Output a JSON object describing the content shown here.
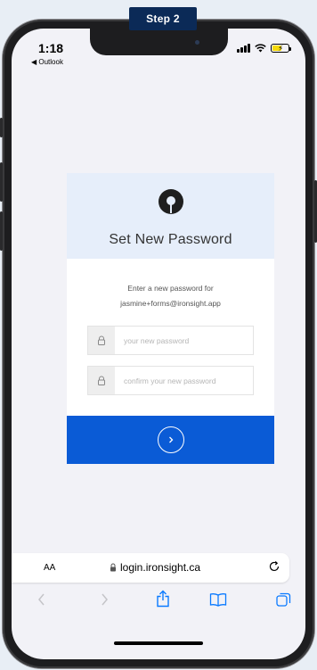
{
  "step_badge": "Step 2",
  "status": {
    "time": "1:18",
    "back_label": "◀ Outlook"
  },
  "card": {
    "title": "Set New Password",
    "instruction_line1": "Enter a new password for",
    "instruction_email": "jasmine+forms@ironsight.app",
    "password_placeholder": "your new password",
    "confirm_placeholder": "confirm your new password",
    "submit_icon": "chevron-right-circle-icon"
  },
  "browser": {
    "text_size_label": "AA",
    "url": "login.ironsight.ca"
  },
  "colors": {
    "step_badge_bg": "#0b2a57",
    "card_header_bg": "#e6eefa",
    "submit_bar_bg": "#0a5bd6",
    "ios_blue": "#0a7aff"
  }
}
